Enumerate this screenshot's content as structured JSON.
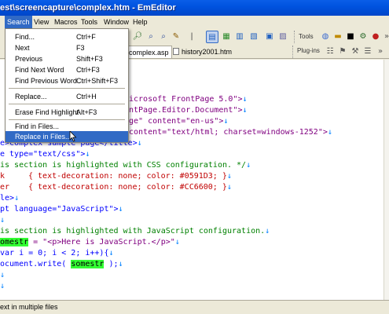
{
  "window": {
    "title": "est\\screencapture\\complex.htm - EmEditor"
  },
  "menu": [
    "Search",
    "View",
    "Macros",
    "Tools",
    "Window",
    "Help"
  ],
  "toolbar2": {
    "tools_label": "Tools",
    "plugins_label": "Plug-ins"
  },
  "tabs": [
    "complex.asp",
    "history2001.htm"
  ],
  "search_menu": {
    "items": [
      {
        "label": "Find...",
        "shortcut": "Ctrl+F"
      },
      {
        "label": "Next",
        "shortcut": "F3"
      },
      {
        "label": "Previous",
        "shortcut": "Shift+F3"
      },
      {
        "label": "Find Next Word",
        "shortcut": "Ctrl+F3"
      },
      {
        "label": "Find Previous Word",
        "shortcut": "Ctrl+Shift+F3"
      },
      {
        "label": "Replace...",
        "shortcut": "Ctrl+H"
      },
      {
        "label": "Erase Find Highlight",
        "shortcut": "Alt+F3"
      },
      {
        "label": "Find in Files...",
        "shortcut": ""
      },
      {
        "label": "Replace in Files...",
        "shortcut": ""
      }
    ]
  },
  "code": {
    "l1": "icrosoft FrontPage 5.0\">",
    "l2": "ntPage.Editor.Document\">",
    "l3a": "ge\" content=\"en-us\">",
    "l4a": "content=\"text/html; charset=windows-1252\">",
    "l5": "e>complex sample page</title>",
    "l6": "e type=\"text/css\">",
    "l7": "is section is highlighted with CSS configuration. */",
    "l8a": "k",
    "l8b": "{ text-decoration: none; color: #0591D3; }",
    "l9a": "er",
    "l9b": "{ text-decoration: none; color: #CC6600; }",
    "l10": "le>",
    "l11": "pt language=\"JavaScript\">",
    "l13": "is section is highlighted with JavaScript configuration.",
    "l14a": "omestr",
    "l14b": " = \"<p>Here is JavaScript.</p>\"",
    "l15": "var i = 0; i < 2; i++){",
    "l16a": "ocument.write( ",
    "l16b": "somestr",
    "l16c": " );",
    "eol": "↓"
  },
  "status": {
    "text": "ext in multiple files"
  }
}
